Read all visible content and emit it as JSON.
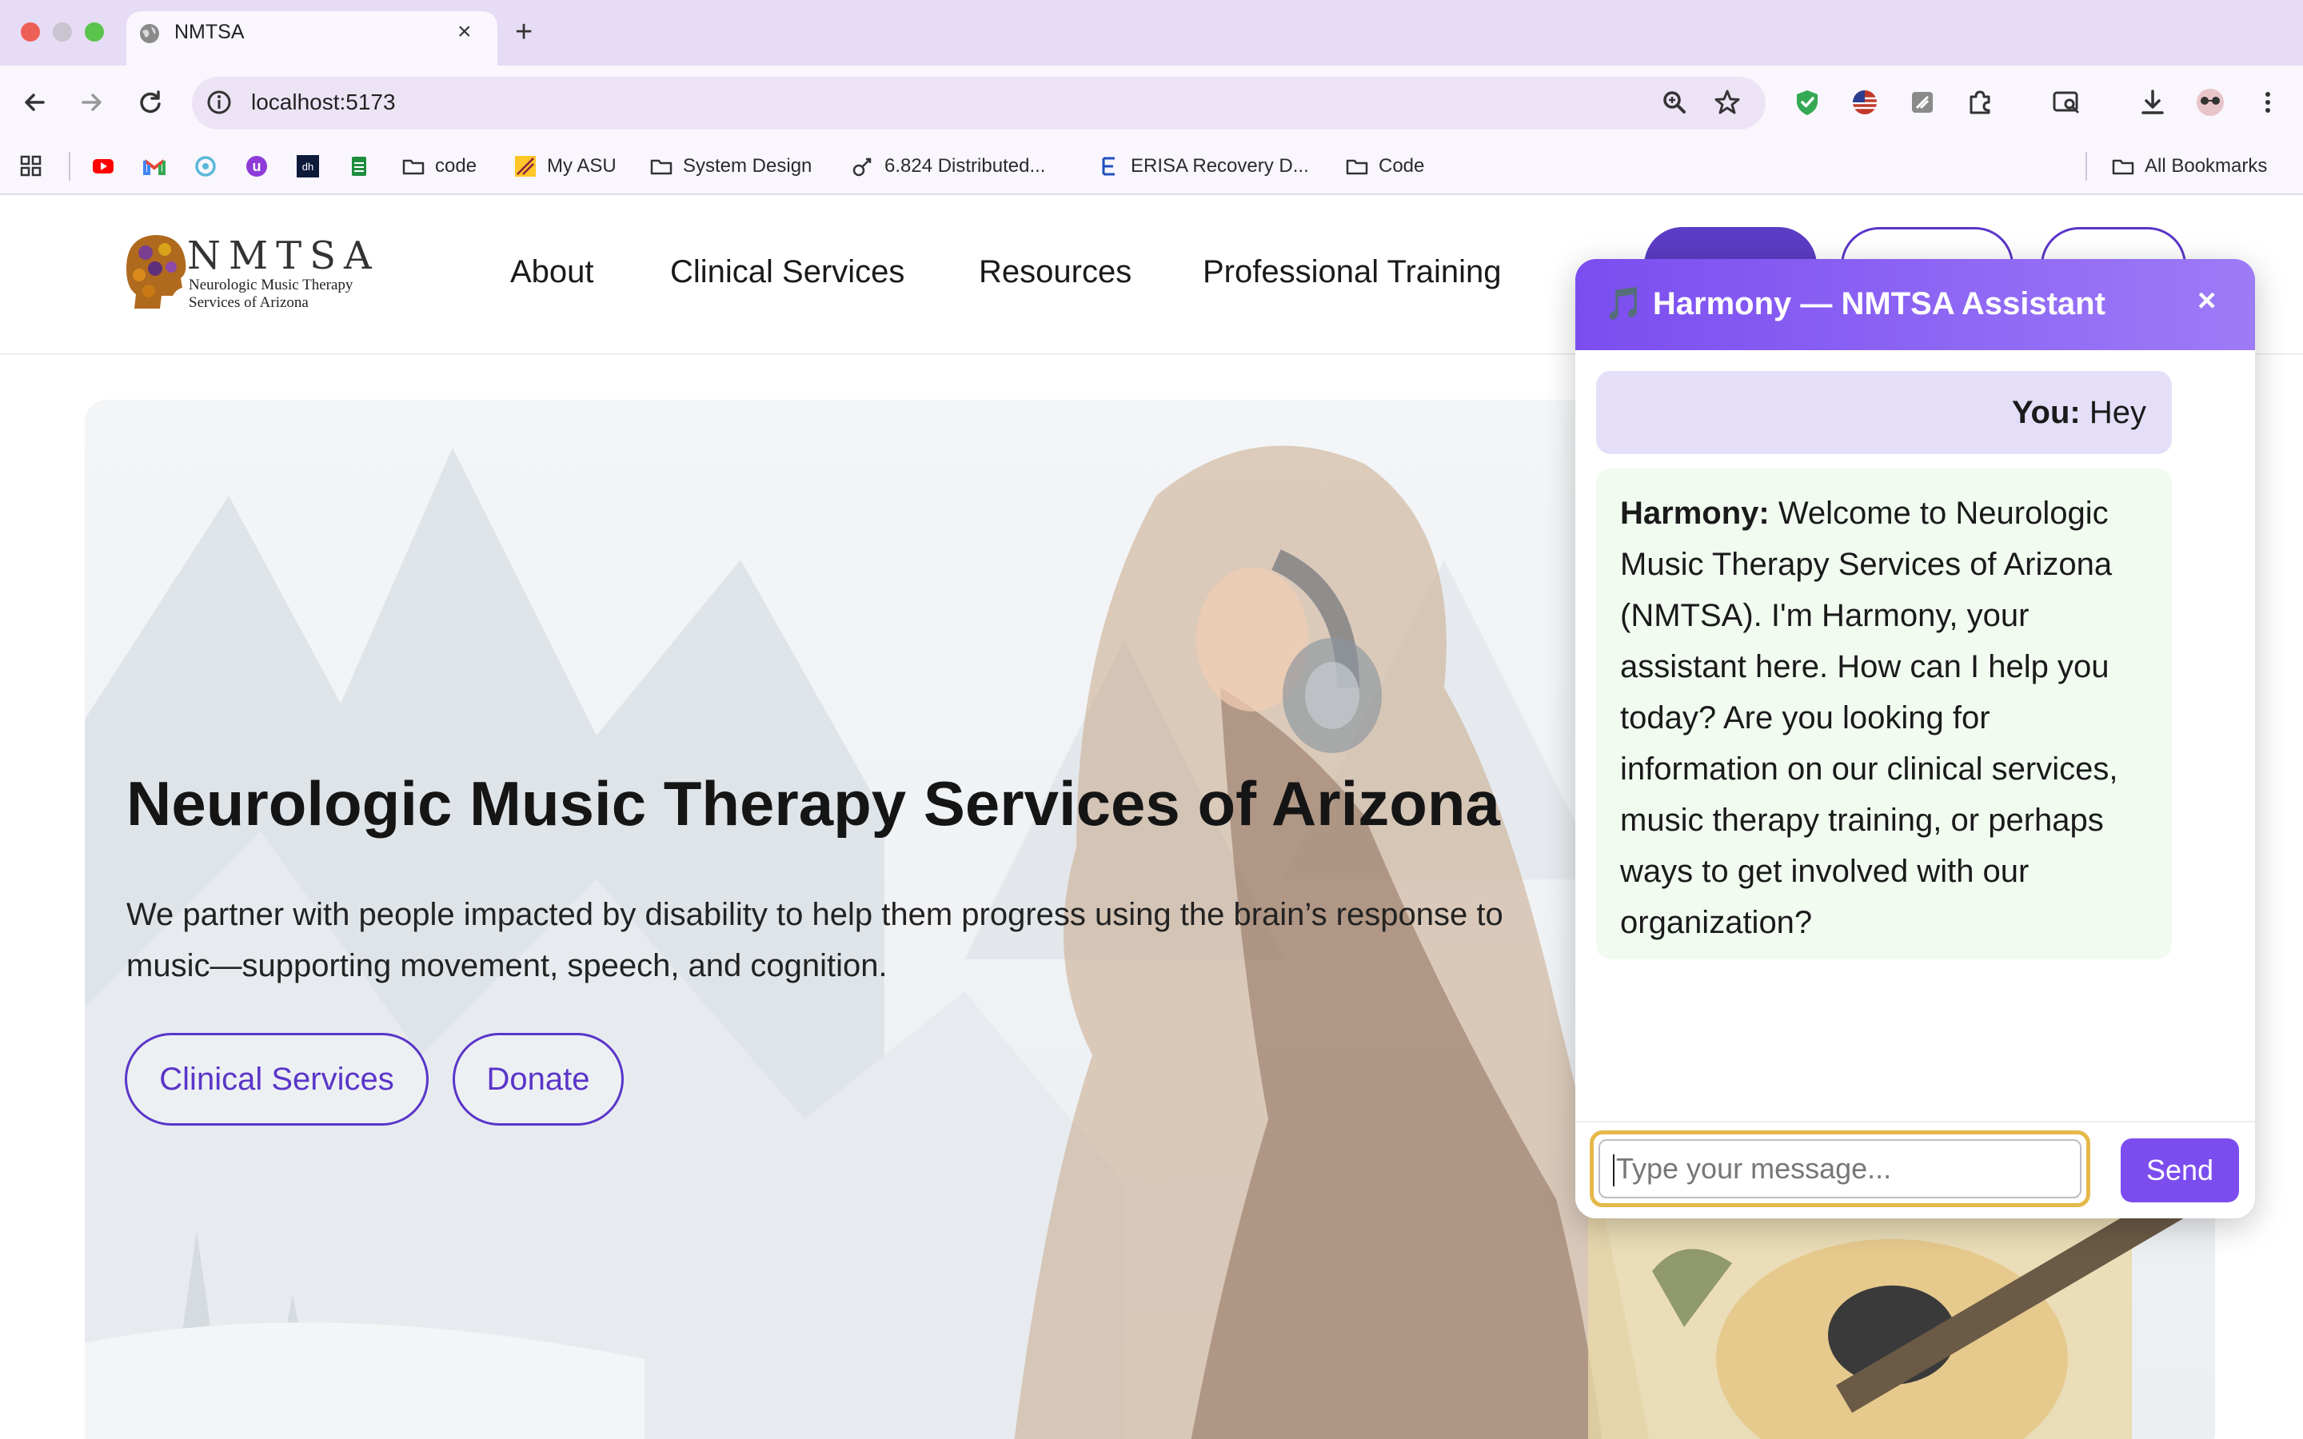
{
  "browser": {
    "tab_title": "NMTSA",
    "url": "localhost:5173",
    "bookmarks": [
      {
        "label": "",
        "icon": "youtube-icon"
      },
      {
        "label": "",
        "icon": "gmail-icon"
      },
      {
        "label": "",
        "icon": "app-icon"
      },
      {
        "label": "",
        "icon": "u-icon"
      },
      {
        "label": "",
        "icon": "dh-icon"
      },
      {
        "label": "",
        "icon": "sheets-icon"
      },
      {
        "label": "code",
        "icon": "folder-icon"
      },
      {
        "label": "My ASU",
        "icon": "asu-icon"
      },
      {
        "label": "System Design",
        "icon": "folder-icon"
      },
      {
        "label": "6.824 Distributed...",
        "icon": "link-icon"
      },
      {
        "label": "ERISA Recovery D...",
        "icon": "e-icon"
      },
      {
        "label": "Code",
        "icon": "folder-icon"
      }
    ],
    "all_bookmarks": "All Bookmarks"
  },
  "site": {
    "logo": {
      "wordmark": "NMTSA",
      "subtitle_line1": "Neurologic Music Therapy",
      "subtitle_line2": "Services of Arizona"
    },
    "nav": [
      "About",
      "Clinical Services",
      "Resources",
      "Professional Training"
    ],
    "hero": {
      "title": "Neurologic Music Therapy Services of Arizona",
      "subtitle": "We partner with people impacted by disability to help them progress using the brain’s response to music—supporting movement, speech, and cognition.",
      "buttons": [
        "Clinical Services",
        "Donate"
      ]
    }
  },
  "chat": {
    "title": "🎵 Harmony — NMTSA Assistant",
    "close": "×",
    "messages": [
      {
        "sender": "You:",
        "text": "Hey"
      },
      {
        "sender": "Harmony:",
        "text": "Welcome to Neurologic Music Therapy Services of Arizona (NMTSA). I'm Harmony, your assistant here. How can I help you today? Are you looking for information on our clinical services, music therapy training, or perhaps ways to get involved with our organization?"
      }
    ],
    "input_placeholder": "Type your message...",
    "send_label": "Send"
  },
  "colors": {
    "accent": "#7c4dee",
    "chat_header": "#8b5cf6",
    "user_bubble": "#e5def9",
    "bot_bubble": "#f1fbf0",
    "input_focus": "#e5b84a",
    "hero_button": "#5a35c9"
  }
}
